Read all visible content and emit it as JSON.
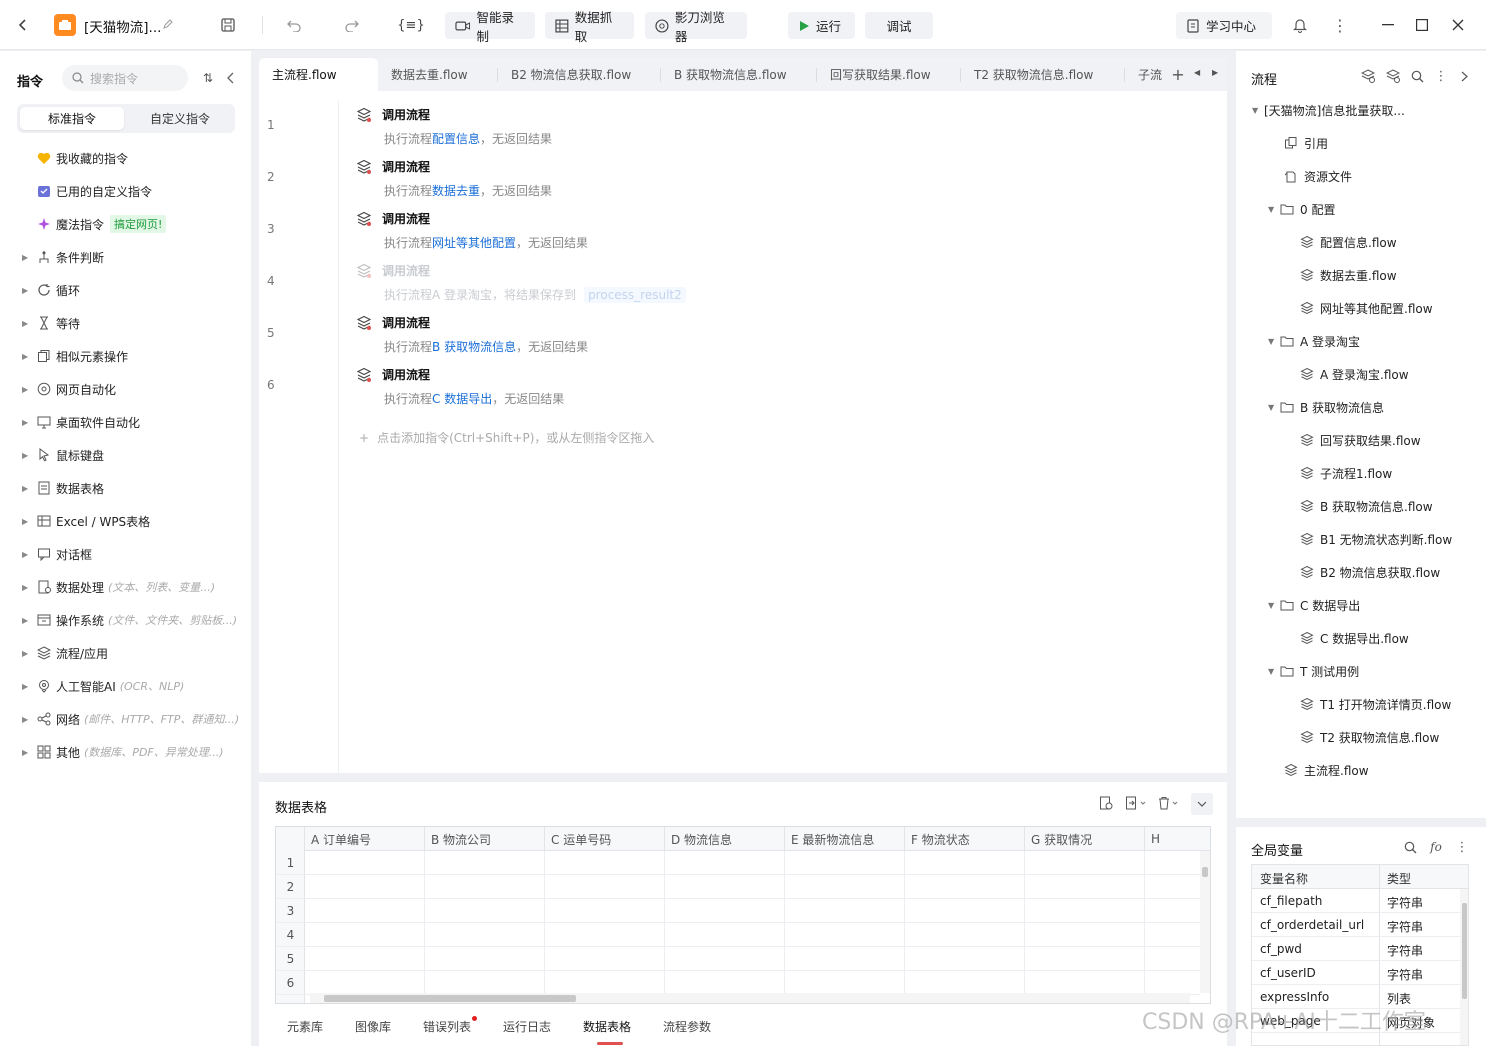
{
  "window": {
    "title": "[天猫物流]...",
    "colors": {
      "accent": "#1a6ed8",
      "run_green": "#26a148",
      "logo": "#ff8a1f",
      "badge_red": "#e02020"
    }
  },
  "toolbar": {
    "smart_record": "智能录制",
    "data_capture": "数据抓取",
    "browser": "影刀浏览器",
    "run": "运行",
    "debug": "调试",
    "learn": "学习中心"
  },
  "left": {
    "title": "指令",
    "search_placeholder": "搜索指令",
    "tab_standard": "标准指令",
    "tab_custom": "自定义指令",
    "fav": "我收藏的指令",
    "used_custom": "已用的自定义指令",
    "magic": "魔法指令",
    "magic_badge": "搞定网页!",
    "categories": [
      {
        "label": "条件判断",
        "hint": ""
      },
      {
        "label": "循环",
        "hint": ""
      },
      {
        "label": "等待",
        "hint": ""
      },
      {
        "label": "相似元素操作",
        "hint": ""
      },
      {
        "label": "网页自动化",
        "hint": ""
      },
      {
        "label": "桌面软件自动化",
        "hint": ""
      },
      {
        "label": "鼠标键盘",
        "hint": ""
      },
      {
        "label": "数据表格",
        "hint": ""
      },
      {
        "label": "Excel / WPS表格",
        "hint": ""
      },
      {
        "label": "对话框",
        "hint": ""
      },
      {
        "label": "数据处理",
        "hint": "(文本、列表、变量...)"
      },
      {
        "label": "操作系统",
        "hint": "(文件、文件夹、剪贴板...)"
      },
      {
        "label": "流程/应用",
        "hint": ""
      },
      {
        "label": "人工智能AI",
        "hint": "(OCR、NLP)"
      },
      {
        "label": "网络",
        "hint": "(邮件、HTTP、FTP、群通知...)"
      },
      {
        "label": "其他",
        "hint": "(数据库、PDF、异常处理...)"
      }
    ]
  },
  "tabs": [
    "主流程.flow",
    "数据去重.flow",
    "B2 物流信息获取.flow",
    "B 获取物流信息.flow",
    "回写获取结果.flow",
    "T2 获取物流信息.flow",
    "子流"
  ],
  "editor": {
    "steps": [
      {
        "no": "1",
        "title": "调用流程",
        "pre": "执行流程",
        "link": "配置信息",
        "post": "，无返回结果",
        "var": ""
      },
      {
        "no": "2",
        "title": "调用流程",
        "pre": "执行流程",
        "link": "数据去重",
        "post": "，无返回结果",
        "var": ""
      },
      {
        "no": "3",
        "title": "调用流程",
        "pre": "执行流程",
        "link": "网址等其他配置",
        "post": "，无返回结果",
        "var": ""
      },
      {
        "no": "4",
        "title": "调用流程",
        "pre": "执行流程",
        "link": "A 登录淘宝",
        "post": "，将结果保存到",
        "var": "process_result2"
      },
      {
        "no": "5",
        "title": "调用流程",
        "pre": "执行流程",
        "link": "B 获取物流信息",
        "post": "，无返回结果",
        "var": ""
      },
      {
        "no": "6",
        "title": "调用流程",
        "pre": "执行流程",
        "link": "C 数据导出",
        "post": "，无返回结果",
        "var": ""
      }
    ],
    "add_hint": "点击添加指令(Ctrl+Shift+P)，或从左侧指令区拖入"
  },
  "bottom": {
    "title": "数据表格",
    "columns": [
      "A 订单编号",
      "B 物流公司",
      "C 运单号码",
      "D 物流信息",
      "E 最新物流信息",
      "F 物流状态",
      "G 获取情况",
      "H"
    ],
    "rows": [
      "1",
      "2",
      "3",
      "4",
      "5",
      "6"
    ],
    "tabs": [
      "元素库",
      "图像库",
      "错误列表",
      "运行日志",
      "数据表格",
      "流程参数"
    ]
  },
  "right": {
    "title": "流程",
    "tree": [
      {
        "label": "[天猫物流]信息批量获取...",
        "lvl": 0,
        "type": "root"
      },
      {
        "label": "引用",
        "lvl": 1,
        "type": "ref"
      },
      {
        "label": "资源文件",
        "lvl": 1,
        "type": "res"
      },
      {
        "label": "0 配置",
        "lvl": 1,
        "type": "folder"
      },
      {
        "label": "配置信息.flow",
        "lvl": 2,
        "type": "flow"
      },
      {
        "label": "数据去重.flow",
        "lvl": 2,
        "type": "flow"
      },
      {
        "label": "网址等其他配置.flow",
        "lvl": 2,
        "type": "flow"
      },
      {
        "label": "A 登录淘宝",
        "lvl": 1,
        "type": "folder"
      },
      {
        "label": "A 登录淘宝.flow",
        "lvl": 2,
        "type": "flow"
      },
      {
        "label": "B 获取物流信息",
        "lvl": 1,
        "type": "folder"
      },
      {
        "label": "回写获取结果.flow",
        "lvl": 2,
        "type": "flow"
      },
      {
        "label": "子流程1.flow",
        "lvl": 2,
        "type": "flow"
      },
      {
        "label": "B 获取物流信息.flow",
        "lvl": 2,
        "type": "flow"
      },
      {
        "label": "B1 无物流状态判断.flow",
        "lvl": 2,
        "type": "flow"
      },
      {
        "label": "B2 物流信息获取.flow",
        "lvl": 2,
        "type": "flow"
      },
      {
        "label": "C 数据导出",
        "lvl": 1,
        "type": "folder"
      },
      {
        "label": "C 数据导出.flow",
        "lvl": 2,
        "type": "flow"
      },
      {
        "label": "T 测试用例",
        "lvl": 1,
        "type": "folder"
      },
      {
        "label": "T1 打开物流详情页.flow",
        "lvl": 2,
        "type": "flow"
      },
      {
        "label": "T2 获取物流信息.flow",
        "lvl": 2,
        "type": "flow"
      },
      {
        "label": "主流程.flow",
        "lvl": 1,
        "type": "flow"
      }
    ]
  },
  "vars": {
    "title": "全局变量",
    "col_name": "变量名称",
    "col_type": "类型",
    "rows": [
      {
        "name": "cf_filepath",
        "type": "字符串"
      },
      {
        "name": "cf_orderdetail_url",
        "type": "字符串"
      },
      {
        "name": "cf_pwd",
        "type": "字符串"
      },
      {
        "name": "cf_userID",
        "type": "字符串"
      },
      {
        "name": "expressInfo",
        "type": "列表"
      },
      {
        "name": "web_page",
        "type": "网页对象"
      }
    ]
  },
  "watermark": "CSDN @RPA+AI十二工作室"
}
